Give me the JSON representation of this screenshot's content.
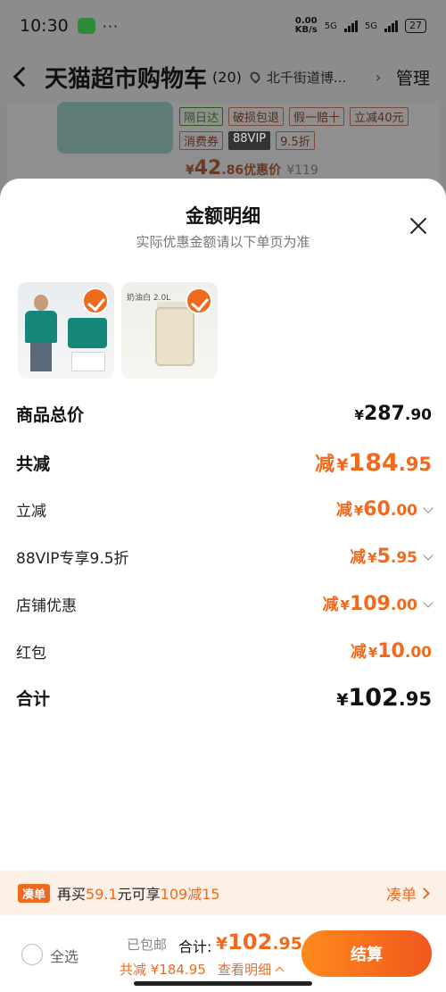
{
  "status_bar": {
    "time": "10:30",
    "net_speed_value": "0.00",
    "net_speed_unit": "KB/s",
    "signal1": "5G",
    "signal2": "5G",
    "battery": "27"
  },
  "header": {
    "title": "天猫超市购物车",
    "count": "(20)",
    "location": "北千街道博...",
    "manage_label": "管理"
  },
  "background_card": {
    "tags": [
      "隔日达",
      "破损包退",
      "假一赔十",
      "立减40元",
      "消费券",
      "88VIP",
      "9.5折"
    ],
    "price_int": "42",
    "price_dec": ".86",
    "price_label": "优惠价",
    "old_price": "¥119"
  },
  "sheet": {
    "title": "金额明细",
    "subtitle": "实际优惠金额请以下单页为准",
    "thumb_jug_label": "奶油白 2.0L",
    "rows": [
      {
        "label": "商品总价",
        "prefix": "",
        "yen": "¥",
        "int": "287",
        "dec": ".90"
      },
      {
        "label": "共减",
        "prefix": "减",
        "yen": "¥",
        "int": "184",
        "dec": ".95"
      },
      {
        "label": "立减",
        "prefix": "减",
        "yen": "¥",
        "int": "60",
        "dec": ".00"
      },
      {
        "label": "88VIP专享9.5折",
        "prefix": "减",
        "yen": "¥",
        "int": "5",
        "dec": ".95"
      },
      {
        "label": "店铺优惠",
        "prefix": "减",
        "yen": "¥",
        "int": "109",
        "dec": ".00"
      },
      {
        "label": "红包",
        "prefix": "减",
        "yen": "¥",
        "int": "10",
        "dec": ".00"
      },
      {
        "label": "合计",
        "prefix": "",
        "yen": "¥",
        "int": "102",
        "dec": ".95"
      }
    ]
  },
  "promo": {
    "badge": "凑单",
    "text_a": "再买",
    "amount": "59.1",
    "text_b": "元可享",
    "deal": "109减15",
    "link": "凑单"
  },
  "footer": {
    "select_all": "全选",
    "shipped": "已包邮",
    "total_label": "合计:",
    "total_yen": "¥",
    "total_int": "102",
    "total_dec": ".95",
    "saved": "共减 ¥184.95",
    "detail_link": "查看明细",
    "checkout": "结算"
  },
  "colors": {
    "accent": "#f06a1d",
    "overlay": "#8c8c8c"
  }
}
